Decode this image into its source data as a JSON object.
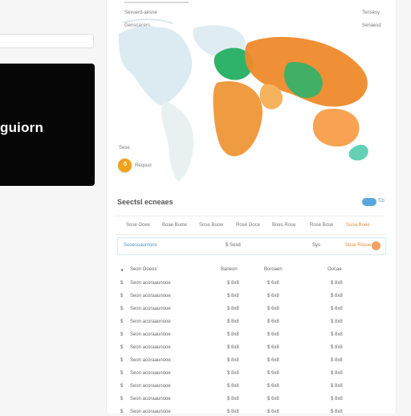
{
  "left": {
    "search_value": "",
    "brand_text": "guiorn"
  },
  "top": {
    "left_line_1": "Sevuerd-aesne",
    "left_line_2": "Genscacers",
    "right_line_1": "Tensesy",
    "right_line_2": "Senaesd"
  },
  "map": {
    "legend_value": "0",
    "legend_caption": "Reqsuo",
    "small_caption": "Sese"
  },
  "section": {
    "title": "Seectsl ecneaes",
    "toggle_label": "Ss"
  },
  "tabs": [
    "Sose Ooee",
    "Boae Buow",
    "Sose Buow",
    "Rose Ooce",
    "Boes Rose",
    "Rose Bose",
    "Suoa Boee"
  ],
  "filter": {
    "label": "Sooesoaumons",
    "mid": "$ Sosd",
    "right": "Sys",
    "orange": "Suse Rosse"
  },
  "table": {
    "headers": [
      "Seon Ooeos",
      "Baneon",
      "Boroaen",
      "Oocae"
    ],
    "rows": [
      [
        "Seon acoraaunooe",
        "$ 8x8",
        "$ 6x8",
        "$ 8x8"
      ],
      [
        "Seon acoraaunooe",
        "$ 8x8",
        "$ 6x8",
        "$ 8x8"
      ],
      [
        "Seon acoraaunooe",
        "$ 8x8",
        "$ 6x8",
        "$ 8x8"
      ],
      [
        "Seon acoraaunooe",
        "$ 8x8",
        "$ 6x8",
        "$ 8x8"
      ],
      [
        "Seon acoraaunooe",
        "$ 8x8",
        "$ 6x8",
        "$ 8x8"
      ],
      [
        "Seon acoraaunooe",
        "$ 8x8",
        "$ 6x8",
        "$ 8x8"
      ],
      [
        "Seon acoraaunooe",
        "$ 8x8",
        "$ 6x8",
        "$ 8x8"
      ],
      [
        "Seon acoraaunooe",
        "$ 8x8",
        "$ 6x8",
        "$ 8x8"
      ],
      [
        "Seon acoraaunooe",
        "$ 8x8",
        "$ 6x8",
        "$ 8x8"
      ],
      [
        "Seon acoraaunooe",
        "$ 8x8",
        "$ 6x8",
        "$ 8x8"
      ],
      [
        "Seon acoraaunooe",
        "$ 8x8",
        "$ 6x8",
        "$ 8x8"
      ]
    ]
  },
  "colors": {
    "orange": "#ee8a2c",
    "green": "#2fb36b",
    "teal": "#8fd7ce",
    "black": "#060606"
  }
}
